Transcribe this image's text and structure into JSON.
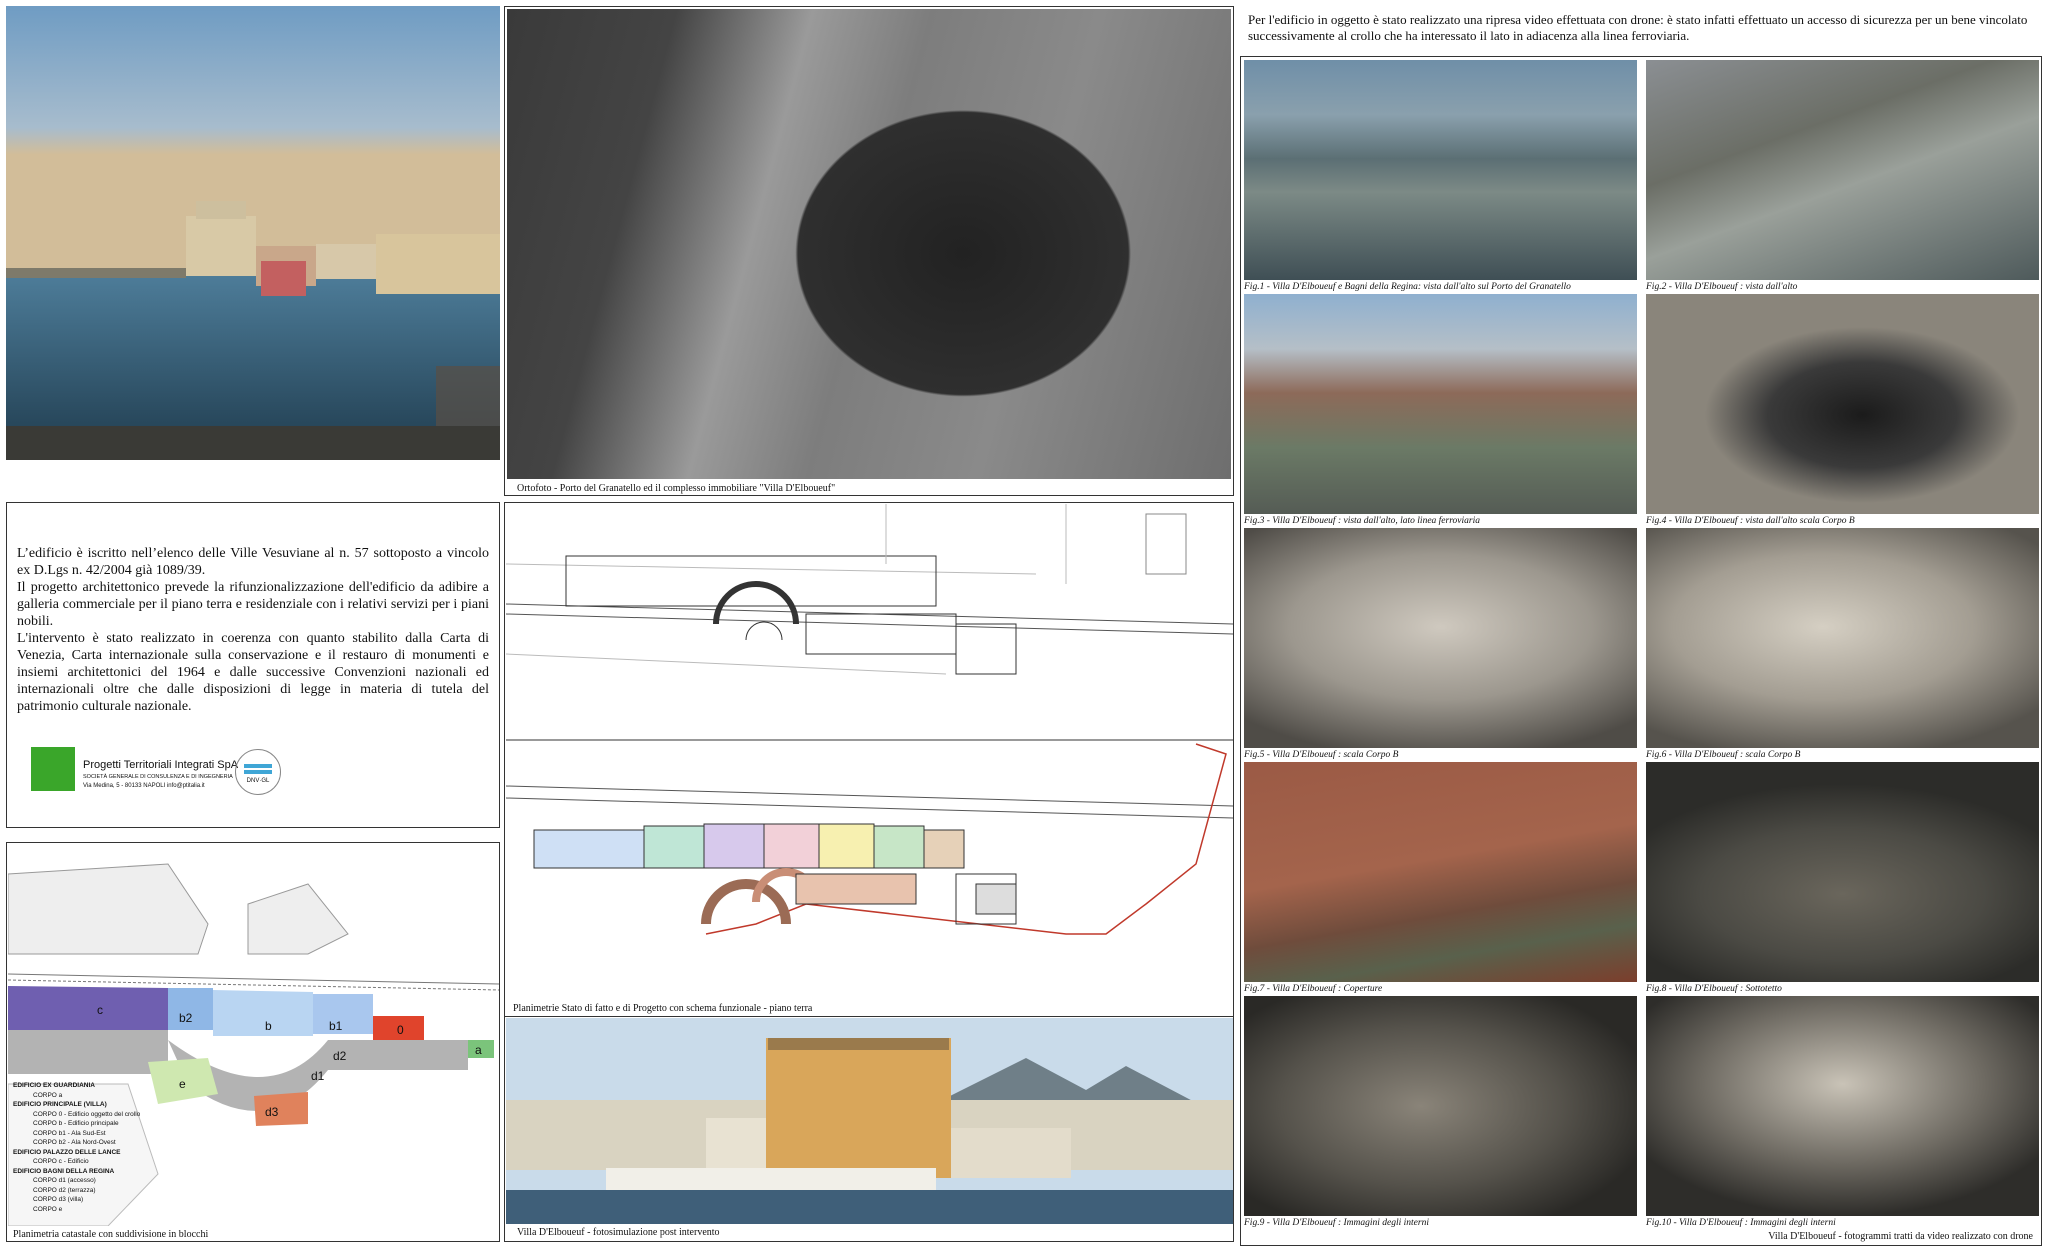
{
  "intro_text": {
    "p1": "L’edificio è iscritto nell’elenco delle Ville Vesuviane al n. 57 sottoposto a vincolo ex D.Lgs n. 42/2004 già 1089/39.",
    "p2": "Il progetto architettonico prevede la rifunzionalizzazione dell'edificio da adibire a galleria commerciale per il piano terra e residenziale con i relativi servizi per i piani nobili.",
    "p3": "L'intervento è stato realizzato in coerenza con quanto stabilito dalla Carta di Venezia, Carta internazionale sulla conservazione e il restauro di monumenti e insiemi architettonici del 1964 e dalle successive Convenzioni nazionali ed internazionali oltre che dalle disposizioni di legge in materia di tutela del patrimonio culturale nazionale."
  },
  "logo": {
    "company": "Progetti Territoriali Integrati SpA",
    "subtitle": "SOCIETÀ GENERALE DI CONSULENZA E DI INGEGNERIA",
    "address": "Via Medina, 5 - 80133 NAPOLI  info@ptitalia.it",
    "badge": "DNV·GL"
  },
  "captions": {
    "ortofoto": "Ortofoto - Porto del Granatello ed il complesso immobiliare \"Villa D'Elboueuf\"",
    "planimetrie": "Planimetrie Stato di fatto e di Progetto con schema funzionale - piano terra",
    "catastale": "Planimetria catastale con suddivisione in blocchi",
    "fotosim": "Villa D'Elboueuf - fotosimulazione post intervento",
    "drone_footer": "Villa D'Elboueuf - fotogrammi tratti da video realizzato con drone"
  },
  "drone_intro": "Per l'edificio in oggetto è stato realizzato una ripresa video effettuata con drone: è stato infatti effettuato un accesso di sicurezza per un bene vincolato successivamente al crollo che ha interessato il lato in adiacenza alla linea ferroviaria.",
  "figures": [
    "Fig.1 - Villa D'Elboueuf e Bagni della Regina: vista dall'alto sul Porto del Granatello",
    "Fig.2 - Villa D'Elboueuf : vista dall'alto",
    "Fig.3 - Villa D'Elboueuf : vista dall'alto, lato linea ferroviaria",
    "Fig.4 - Villa D'Elboueuf : vista dall'alto scala Corpo B",
    "Fig.5 - Villa D'Elboueuf : scala Corpo B",
    "Fig.6 - Villa D'Elboueuf : scala Corpo B",
    "Fig.7 - Villa D'Elboueuf : Coperture",
    "Fig.8 - Villa D'Elboueuf : Sottotetto",
    "Fig.9 - Villa D'Elboueuf : Immagini degli interni",
    "Fig.10 - Villa D'Elboueuf : Immagini degli interni"
  ],
  "blocks": {
    "c": "c",
    "b2": "b2",
    "b": "b",
    "b1": "b1",
    "zero": "0",
    "a": "a",
    "d2": "d2",
    "d1": "d1",
    "e": "e",
    "d3": "d3"
  },
  "legend": [
    {
      "text": "EDIFICIO EX GUARDIANIA",
      "header": true
    },
    {
      "text": "CORPO a",
      "header": false
    },
    {
      "text": "EDIFICIO PRINCIPALE (VILLA)",
      "header": true
    },
    {
      "text": "CORPO 0 - Edificio oggetto del crollo",
      "header": false
    },
    {
      "text": "CORPO b - Edificio principale",
      "header": false
    },
    {
      "text": "CORPO b1 - Ala Sud-Est",
      "header": false
    },
    {
      "text": "CORPO b2 - Ala Nord-Ovest",
      "header": false
    },
    {
      "text": "EDIFICIO PALAZZO DELLE LANCE",
      "header": true
    },
    {
      "text": "CORPO c - Edificio",
      "header": false
    },
    {
      "text": "EDIFICIO BAGNI DELLA REGINA",
      "header": true
    },
    {
      "text": "CORPO d1 (accesso)",
      "header": false
    },
    {
      "text": "CORPO d2 (terrazza)",
      "header": false
    },
    {
      "text": "CORPO d3 (villa)",
      "header": false
    },
    {
      "text": "CORPO e",
      "header": false
    }
  ],
  "colors": {
    "c": "#6f5fb0",
    "b2": "#8fb7e6",
    "b": "#b9d5f2",
    "b1": "#a9c7ee",
    "zero": "#e0442c",
    "a": "#7bc47b",
    "d": "#b3b3b3",
    "e": "#cfe8b0",
    "d3": "#e0825c",
    "logo_green": "#3aa62a"
  }
}
